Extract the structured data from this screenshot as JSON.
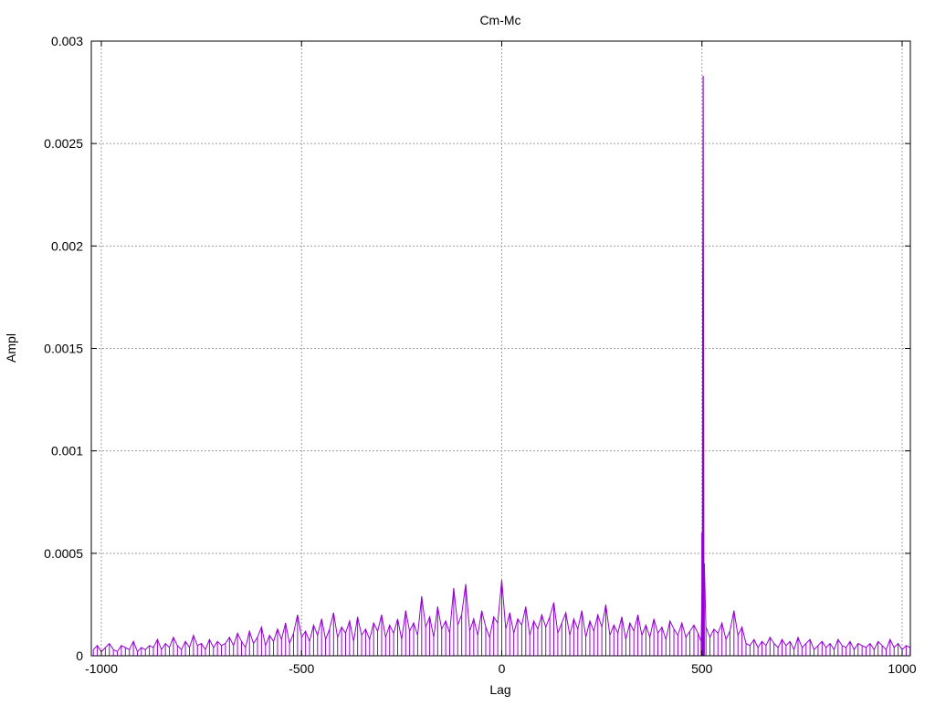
{
  "chart_data": {
    "type": "line",
    "title": "Cm-Mc",
    "xlabel": "Lag",
    "ylabel": "Ampl",
    "xlim": [
      -1025,
      1020
    ],
    "ylim": [
      0,
      0.003
    ],
    "grid": true,
    "legend": "none",
    "x_ticks": [
      -1000,
      -500,
      0,
      500,
      1000
    ],
    "x_tick_labels": [
      "-1000",
      "-500",
      "0",
      "500",
      "1000"
    ],
    "y_ticks": [
      0,
      0.0005,
      0.001,
      0.0015,
      0.002,
      0.0025,
      0.003
    ],
    "y_tick_labels": [
      "0",
      "0.0005",
      "0.001",
      "0.0015",
      "0.002",
      "0.0025",
      "0.003"
    ],
    "series": [
      {
        "name": "Cm-Mc",
        "color": "#9400d3",
        "value_scale": 1e-05,
        "x_start": -1020,
        "x_step": 10,
        "values_scaled": [
          3,
          5,
          2,
          4,
          6,
          3,
          2,
          5,
          4,
          3,
          7,
          2,
          4,
          3,
          5,
          4,
          8,
          3,
          6,
          4,
          9,
          5,
          3,
          7,
          4,
          10,
          5,
          6,
          3,
          8,
          4,
          7,
          5,
          6,
          9,
          5,
          11,
          7,
          4,
          12,
          6,
          9,
          14,
          5,
          10,
          7,
          13,
          8,
          16,
          6,
          11,
          20,
          9,
          12,
          7,
          15,
          10,
          18,
          8,
          13,
          21,
          9,
          14,
          11,
          17,
          7,
          19,
          10,
          13,
          8,
          16,
          12,
          20,
          9,
          15,
          11,
          18,
          8,
          22,
          12,
          16,
          10,
          29,
          14,
          19,
          9,
          24,
          13,
          17,
          11,
          33,
          15,
          20,
          35,
          12,
          18,
          10,
          22,
          14,
          9,
          19,
          16,
          37,
          13,
          21,
          11,
          18,
          15,
          24,
          10,
          17,
          13,
          20,
          14,
          19,
          26,
          11,
          16,
          21,
          10,
          18,
          13,
          22,
          9,
          17,
          12,
          20,
          14,
          25,
          10,
          15,
          11,
          19,
          8,
          16,
          12,
          20,
          10,
          15,
          9,
          18,
          11,
          14,
          8,
          17,
          13,
          10,
          16,
          9,
          12,
          15,
          11,
          30,
          14,
          9,
          13,
          11,
          16,
          8,
          12,
          22,
          10,
          14,
          6,
          5,
          8,
          4,
          7,
          5,
          9,
          6,
          4,
          8,
          5,
          7,
          3,
          9,
          4,
          6,
          8,
          3,
          5,
          7,
          4,
          6,
          3,
          8,
          5,
          4,
          7,
          3,
          6,
          5,
          4,
          6,
          3,
          7,
          5,
          3,
          8,
          4,
          6,
          3,
          5,
          4
        ],
        "peak_points_scaled": [
          [
            498,
            7
          ],
          [
            500,
            60
          ],
          [
            501,
            34
          ],
          [
            502,
            189
          ],
          [
            503,
            283
          ],
          [
            504,
            165
          ],
          [
            505,
            40
          ],
          [
            506,
            45
          ]
        ]
      }
    ]
  }
}
